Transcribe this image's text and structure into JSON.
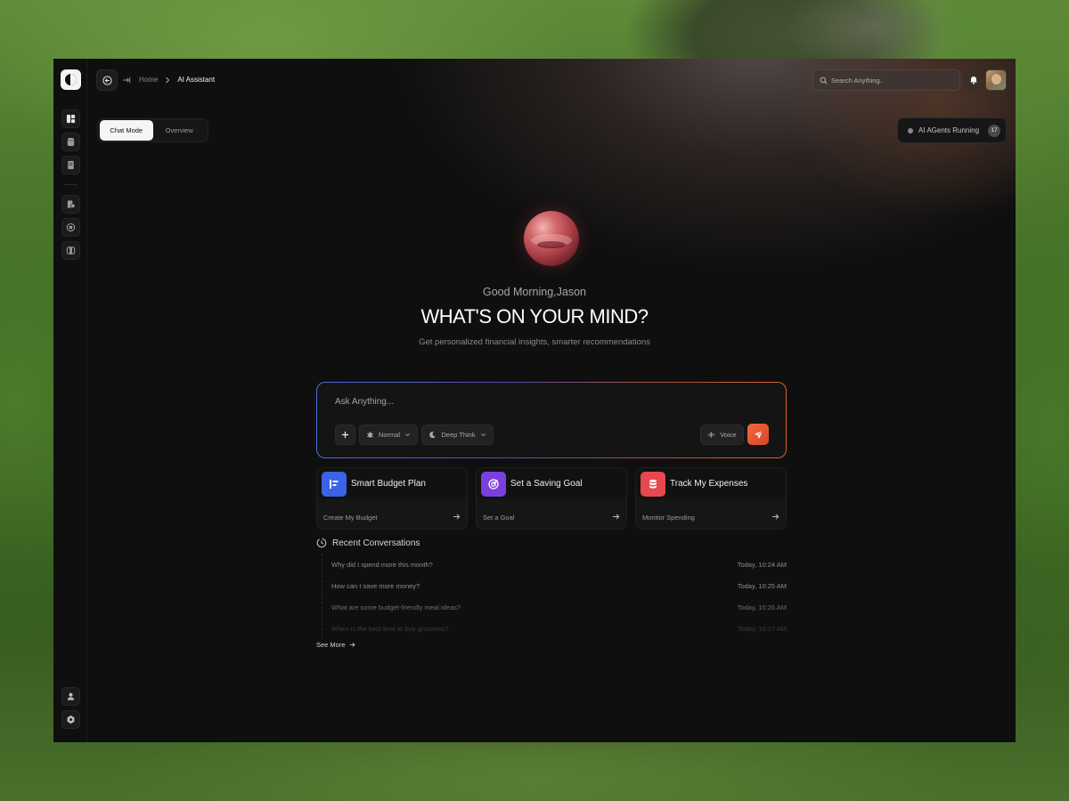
{
  "topbar": {
    "breadcrumb_home": "Home",
    "breadcrumb_current": "AI Assistant",
    "search_placeholder": "Search Anything.."
  },
  "modes": {
    "chat": "Chat Mode",
    "overview": "Overview"
  },
  "agents": {
    "label": "AI AGents Running",
    "count": "17"
  },
  "hero": {
    "greeting": "Good Morning,Jason",
    "headline": "WHAT'S ON YOUR MIND?",
    "subline": "Get personalized financial insights, smarter recommendations"
  },
  "chat": {
    "placeholder": "Ask Anything...",
    "mode_normal": "Normal",
    "mode_deep": "Deep Think",
    "voice": "Voice"
  },
  "cards": [
    {
      "title": "Smart Budget Plan",
      "action": "Create My Budget",
      "color": "#3a63e6"
    },
    {
      "title": "Set a Saving Goal",
      "action": "Set a Goal",
      "color": "#7b3fe0"
    },
    {
      "title": "Track My Expenses",
      "action": "Monitor Spending",
      "color": "#e5484d"
    }
  ],
  "recent": {
    "title": "Recent Conversations",
    "items": [
      {
        "q": "Why did I spend more this month?",
        "t": "Today, 10:24 AM"
      },
      {
        "q": "How can I save more money?",
        "t": "Today, 10:25 AM"
      },
      {
        "q": "What are some budget-friendly meal ideas?",
        "t": "Today, 10:26 AM"
      },
      {
        "q": "When is the best time to buy groceries?",
        "t": "Today, 10:27 AM"
      }
    ],
    "see_more": "See More"
  },
  "icons": {
    "sidebar_top": [
      "dashboard-icon",
      "database-icon",
      "document-icon"
    ],
    "sidebar_mid": [
      "receipt-icon",
      "target-icon",
      "wallet-icon"
    ],
    "sidebar_bottom": [
      "user-icon",
      "settings-icon"
    ]
  }
}
